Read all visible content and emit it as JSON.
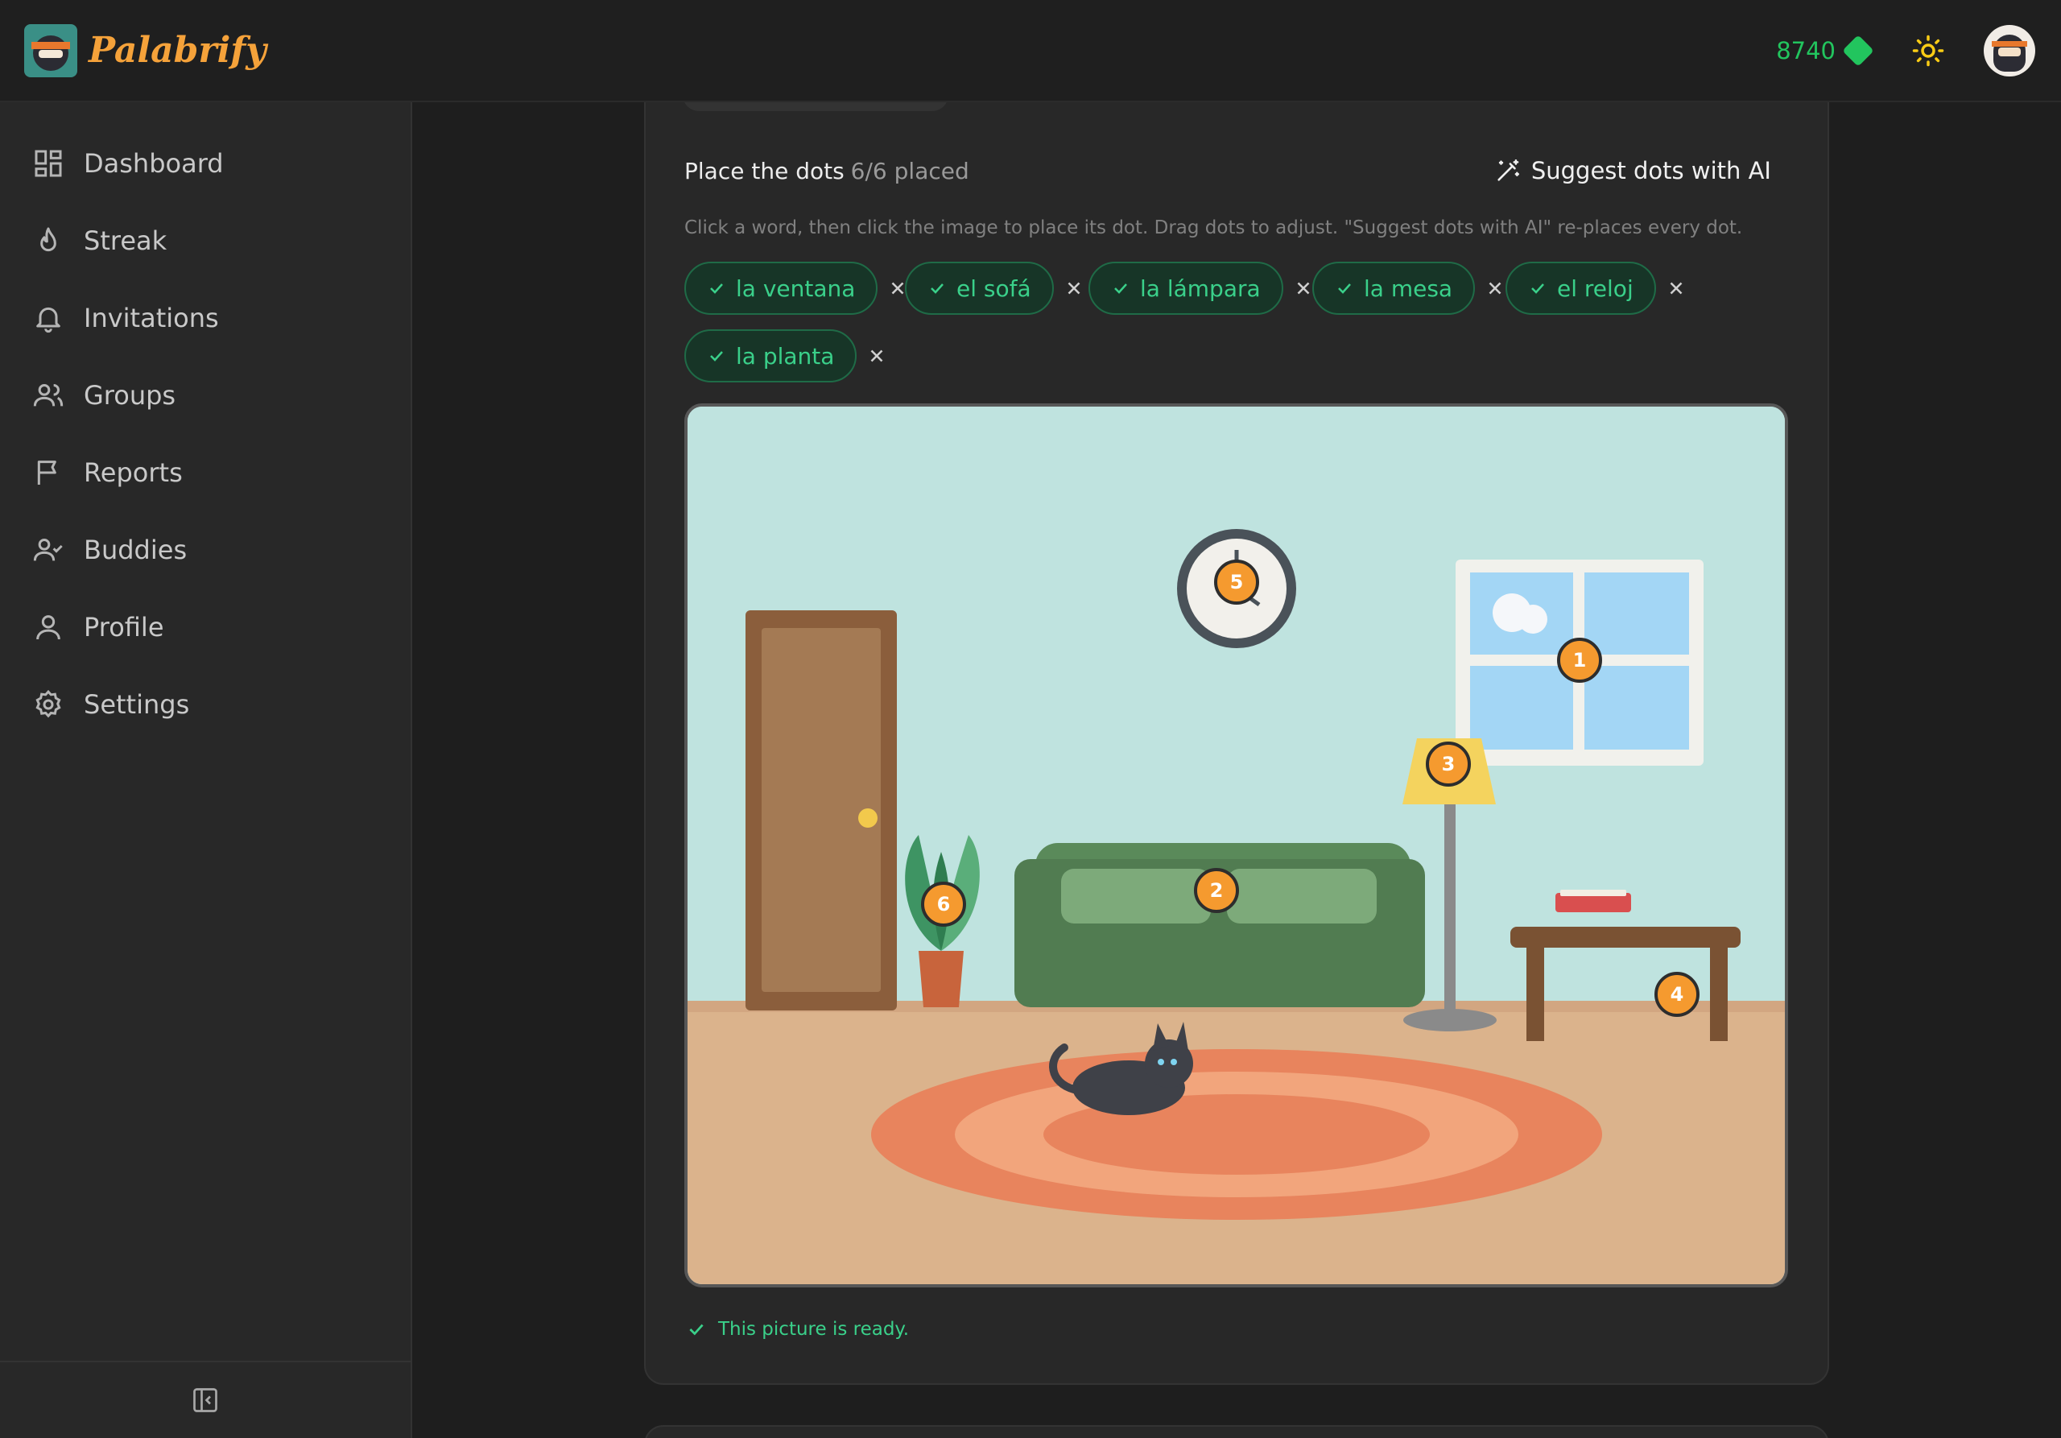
{
  "app": {
    "name": "Palabrify"
  },
  "header": {
    "gems": "8740"
  },
  "sidebar": {
    "items": [
      {
        "label": "Dashboard",
        "icon": "dashboard-icon"
      },
      {
        "label": "Streak",
        "icon": "flame-icon"
      },
      {
        "label": "Invitations",
        "icon": "bell-icon"
      },
      {
        "label": "Groups",
        "icon": "users-icon"
      },
      {
        "label": "Reports",
        "icon": "flag-icon"
      },
      {
        "label": "Buddies",
        "icon": "user-check-icon"
      },
      {
        "label": "Profile",
        "icon": "user-icon"
      },
      {
        "label": "Settings",
        "icon": "gear-icon"
      }
    ]
  },
  "editor": {
    "title": "Place the dots",
    "count": "6/6 placed",
    "suggest_label": "Suggest dots with AI",
    "hint": "Click a word, then click the image to place its dot. Drag dots to adjust. \"Suggest dots with AI\" re-places every dot.",
    "words": [
      "la ventana",
      "el sofá",
      "la lámpara",
      "la mesa",
      "el reloj",
      "la planta"
    ],
    "dots": [
      "1",
      "2",
      "3",
      "4",
      "5",
      "6"
    ],
    "ready_text": "This picture is ready."
  },
  "colors": {
    "accent_green": "#22c55e",
    "chip_text": "#3ad08a",
    "dot_orange": "#f59a2f",
    "brand_orange": "#f5a23a"
  }
}
